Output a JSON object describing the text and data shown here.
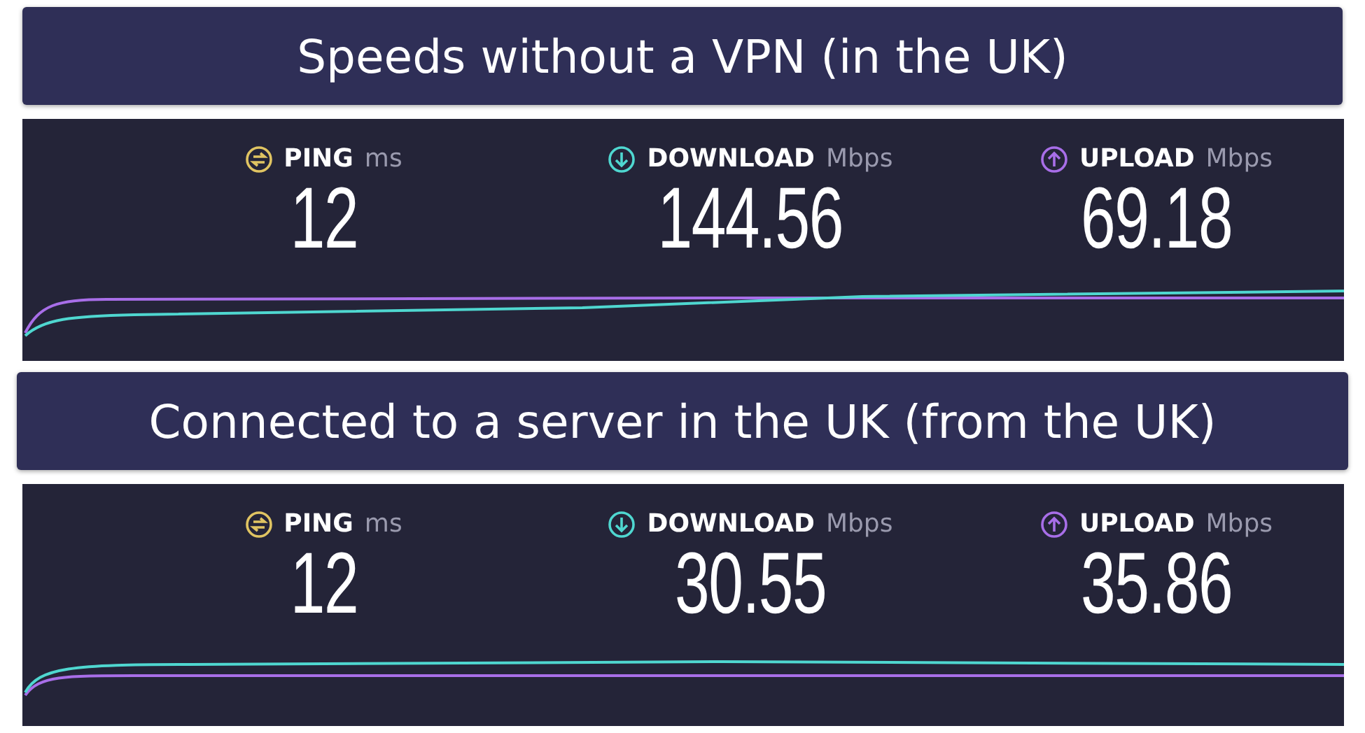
{
  "sections": [
    {
      "title": "Speeds without a VPN (in the UK)",
      "metrics": [
        {
          "kind": "ping",
          "label": "PING",
          "unit": "ms",
          "value": "12"
        },
        {
          "kind": "download",
          "label": "DOWNLOAD",
          "unit": "Mbps",
          "value": "144.56"
        },
        {
          "kind": "upload",
          "label": "UPLOAD",
          "unit": "Mbps",
          "value": "69.18"
        }
      ]
    },
    {
      "title": "Connected to a server in the UK (from the UK)",
      "metrics": [
        {
          "kind": "ping",
          "label": "PING",
          "unit": "ms",
          "value": "12"
        },
        {
          "kind": "download",
          "label": "DOWNLOAD",
          "unit": "Mbps",
          "value": "30.55"
        },
        {
          "kind": "upload",
          "label": "UPLOAD",
          "unit": "Mbps",
          "value": "35.86"
        }
      ]
    }
  ]
}
